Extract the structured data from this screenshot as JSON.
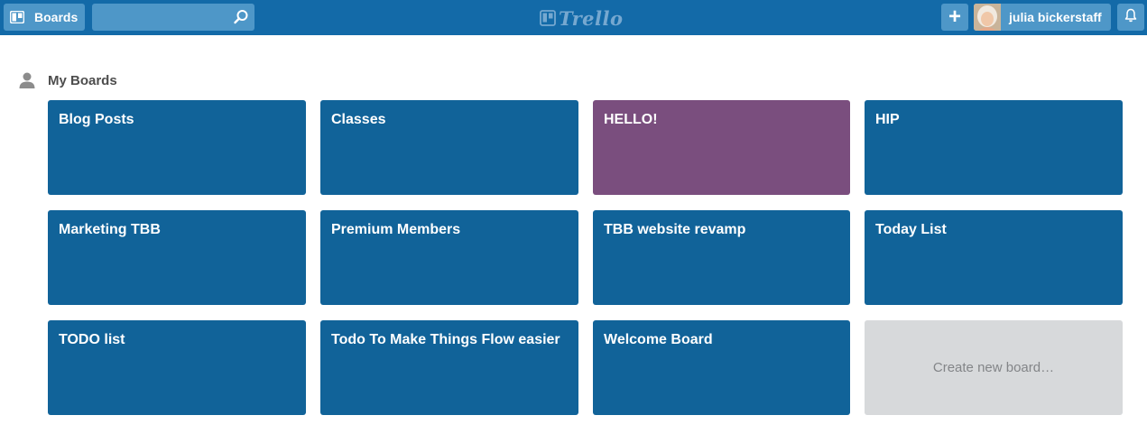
{
  "header": {
    "boards_label": "Boards",
    "search_value": "",
    "logo_text": "Trello",
    "add_label": "+",
    "user_name": "julia bickerstaff"
  },
  "section": {
    "title": "My Boards"
  },
  "boards": [
    {
      "name": "Blog Posts",
      "color": "#116399"
    },
    {
      "name": "Classes",
      "color": "#116399"
    },
    {
      "name": "HELLO!",
      "color": "#7a4e7e"
    },
    {
      "name": "HIP",
      "color": "#116399"
    },
    {
      "name": "Marketing TBB",
      "color": "#116399"
    },
    {
      "name": "Premium Members",
      "color": "#116399"
    },
    {
      "name": "TBB website revamp",
      "color": "#116399"
    },
    {
      "name": "Today List",
      "color": "#116399"
    },
    {
      "name": "TODO list",
      "color": "#116399"
    },
    {
      "name": "Todo To Make Things Flow easier",
      "color": "#116399"
    },
    {
      "name": "Welcome Board",
      "color": "#116399"
    }
  ],
  "create_board_label": "Create new board…",
  "colors": {
    "header_bg": "#136aa8",
    "header_button": "#4e97c8",
    "board_blue": "#116399",
    "board_purple": "#7a4e7e",
    "create_bg": "#d7d9db"
  },
  "icons": {
    "boards_button": "boards-icon",
    "search": "search-icon",
    "logo": "trello-logo-icon",
    "add": "plus-icon",
    "notifications": "bell-icon",
    "section": "person-icon"
  }
}
